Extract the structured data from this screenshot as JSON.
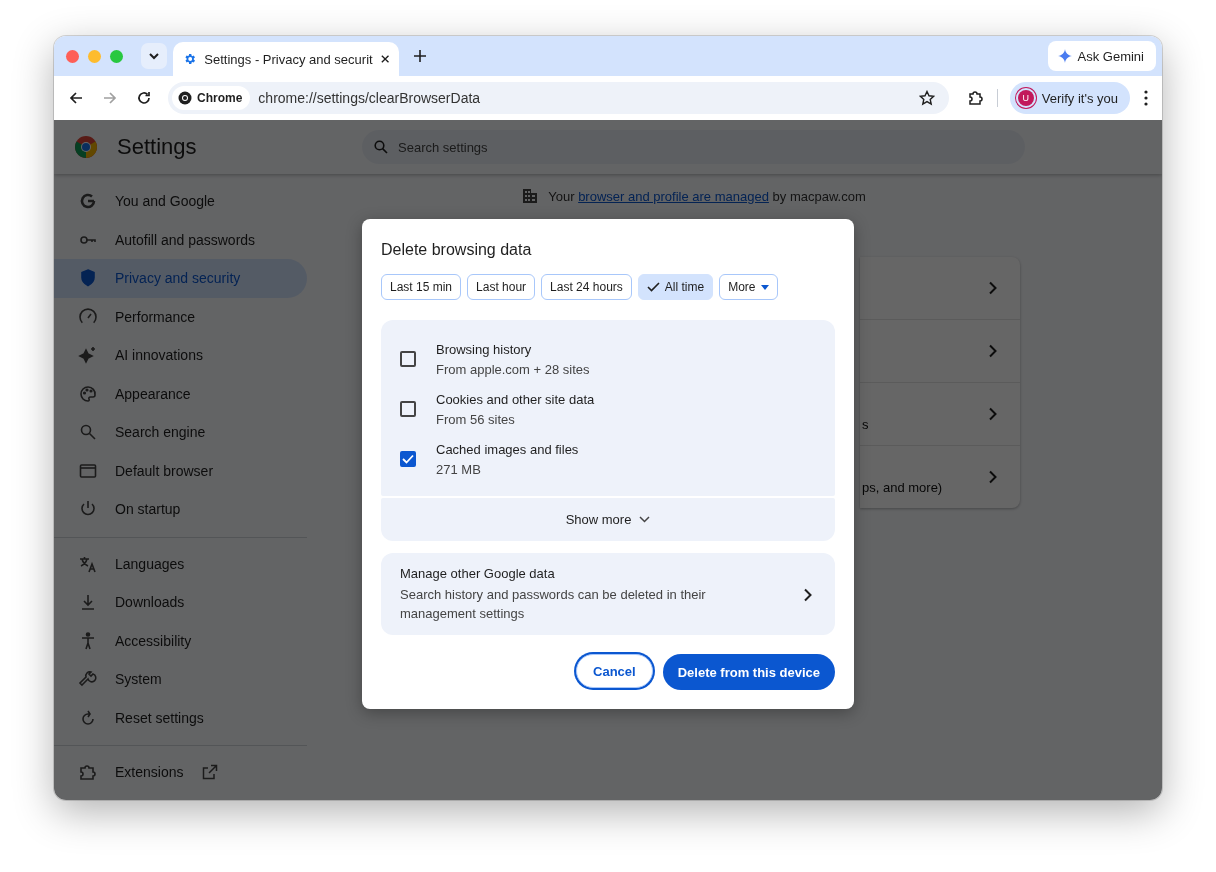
{
  "tabs": [
    {
      "title": "Settings - Privacy and securit",
      "selected": true
    }
  ],
  "ask_gemini": "Ask Gemini",
  "toolbar": {
    "site_chip": "Chrome",
    "url": "chrome://settings/clearBrowserData",
    "profile_button": "Verify it's you",
    "avatar_letter": "U"
  },
  "settings": {
    "title": "Settings",
    "search_placeholder": "Search settings",
    "sidebar": {
      "groups": [
        [
          {
            "label": "You and Google",
            "selected": false
          },
          {
            "label": "Autofill and passwords",
            "selected": false
          },
          {
            "label": "Privacy and security",
            "selected": true
          },
          {
            "label": "Performance",
            "selected": false
          },
          {
            "label": "AI innovations",
            "selected": false
          },
          {
            "label": "Appearance",
            "selected": false
          },
          {
            "label": "Search engine",
            "selected": false
          },
          {
            "label": "Default browser",
            "selected": false
          },
          {
            "label": "On startup",
            "selected": false
          }
        ],
        [
          {
            "label": "Languages",
            "selected": false
          },
          {
            "label": "Downloads",
            "selected": false
          },
          {
            "label": "Accessibility",
            "selected": false
          },
          {
            "label": "System",
            "selected": false
          },
          {
            "label": "Reset settings",
            "selected": false
          }
        ],
        [
          {
            "label": "Extensions",
            "selected": false
          }
        ]
      ]
    },
    "managed_notice": {
      "before": "Your",
      "link": "browser and profile are managed",
      "after": "by macpaw.com"
    },
    "background_card": {
      "rows": [
        {
          "chevron": true
        },
        {
          "chevron": true
        },
        {
          "chevron": true,
          "visible_text": "s"
        },
        {
          "chevron": true,
          "visible_text": "ps, and more)"
        }
      ]
    }
  },
  "dialog": {
    "title": "Delete browsing data",
    "time_ranges": [
      {
        "label": "Last 15 min",
        "selected": false
      },
      {
        "label": "Last hour",
        "selected": false
      },
      {
        "label": "Last 24 hours",
        "selected": false
      },
      {
        "label": "All time",
        "selected": true
      },
      {
        "label": "More",
        "selected": false
      }
    ],
    "items": [
      {
        "title": "Browsing history",
        "subtitle": "From apple.com + 28 sites",
        "checked": false
      },
      {
        "title": "Cookies and other site data",
        "subtitle": "From 56 sites",
        "checked": false
      },
      {
        "title": "Cached images and files",
        "subtitle": "271 MB",
        "checked": true
      }
    ],
    "show_more": "Show more",
    "manage": {
      "title": "Manage other Google data",
      "description": "Search history and passwords can be deleted in their management settings"
    },
    "cancel": "Cancel",
    "confirm": "Delete from this device"
  }
}
